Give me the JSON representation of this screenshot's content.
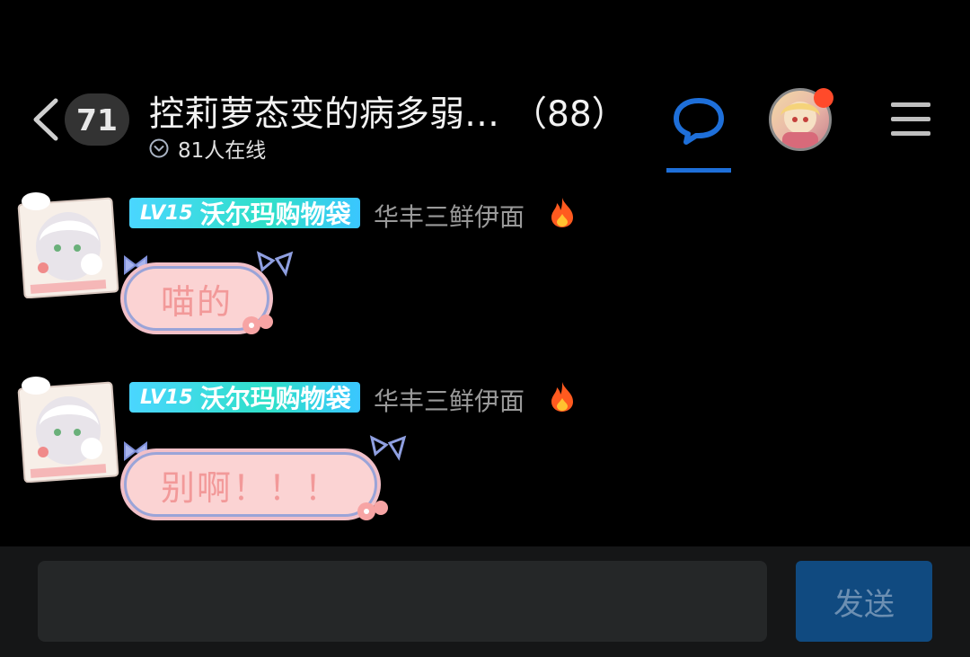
{
  "header": {
    "unread_count": "71",
    "title": "控莉萝态变的病多弱…",
    "member_count": "（88）",
    "online_text": "81人在线",
    "accent_color": "#1e6fd9",
    "notification_dot_color": "#ff4a2a"
  },
  "messages": [
    {
      "level": "LV15",
      "badge_name": "沃尔玛购物袋",
      "nickname": "华丰三鲜伊面",
      "text": "喵的"
    },
    {
      "level": "LV15",
      "badge_name": "沃尔玛购物袋",
      "nickname": "华丰三鲜伊面",
      "text": "别啊！！！"
    }
  ],
  "input_bar": {
    "placeholder": "",
    "send_label": "发送"
  },
  "icons": {
    "back": "chevron-left-icon",
    "online": "chevron-down-circle-icon",
    "chat": "chat-bubble-icon",
    "menu": "hamburger-menu-icon",
    "fire": "fire-icon"
  }
}
